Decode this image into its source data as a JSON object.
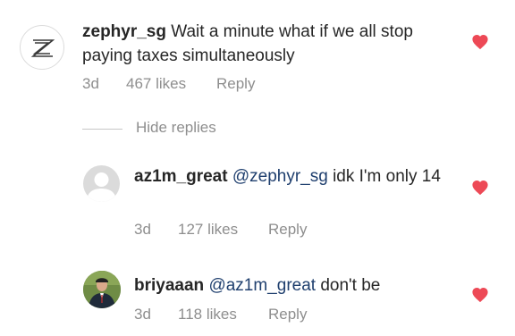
{
  "comments": [
    {
      "username": "zephyr_sg",
      "mention": "",
      "text": " Wait a minute what if we all stop paying taxes simultaneously",
      "time": "3d",
      "likes": "467 likes",
      "reply": "Reply",
      "avatar_icon": "z-logo-icon"
    },
    {
      "username": "az1m_great",
      "mention": "@zephyr_sg",
      "text": " idk I'm only 14",
      "time": "3d",
      "likes": "127 likes",
      "reply": "Reply",
      "avatar_icon": "default-user-icon"
    },
    {
      "username": "briyaaan",
      "mention": "@az1m_great",
      "text": " don't be",
      "time": "3d",
      "likes": "118 likes",
      "reply": "Reply",
      "avatar_icon": "user-photo"
    }
  ],
  "hide_replies_label": "Hide replies",
  "colors": {
    "heart": "#ed4956",
    "mention": "#1f3f6e",
    "meta": "#8e8e8e",
    "text": "#262626"
  }
}
